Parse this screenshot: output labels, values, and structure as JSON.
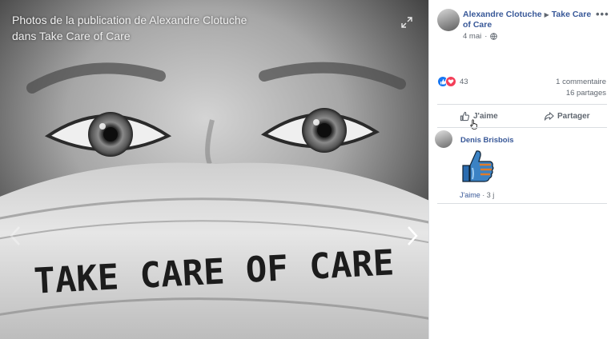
{
  "viewer": {
    "title": "Photos de la publication de Alexandre Clotuche dans Take Care of Care",
    "mask_text": "TAKE CARE OF CARE"
  },
  "post": {
    "author": "Alexandre Clotuche",
    "group": "Take Care of Care",
    "date": "4 mai",
    "more_label": "•••",
    "reactions_count": "43",
    "comments_label": "1 commentaire",
    "shares_label": "16 partages",
    "like_label": "J'aime",
    "share_label": "Partager"
  },
  "comment": {
    "author": "Denis Brisbois",
    "like_link": "J'aime",
    "separator": "·",
    "age": "3 j"
  },
  "colors": {
    "link": "#385898",
    "secondary_text": "#606770",
    "like_blue": "#1877f2",
    "love_red": "#f33e58",
    "divider": "#dadde1"
  },
  "icons": [
    "expand-icon",
    "chevron-left-icon",
    "chevron-right-icon",
    "globe-icon",
    "like-reaction-icon",
    "love-reaction-icon",
    "thumbs-up-icon",
    "share-arrow-icon",
    "hand-cursor-icon",
    "thumbs-up-sticker"
  ]
}
